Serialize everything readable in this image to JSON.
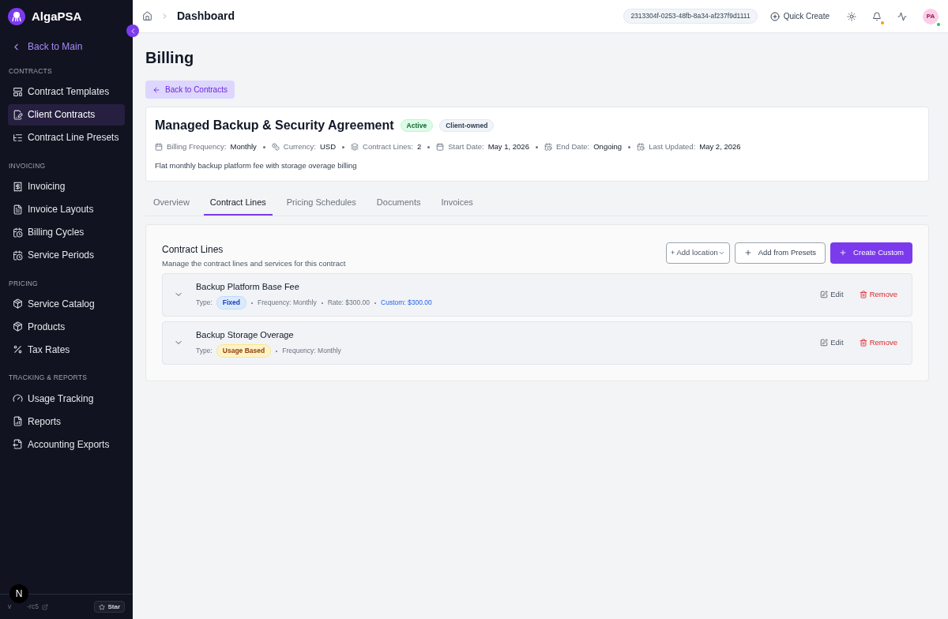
{
  "sidebar": {
    "brand": "AlgaPSA",
    "back": "Back to Main",
    "sections": [
      {
        "title": "CONTRACTS",
        "items": [
          {
            "label": "Contract Templates",
            "selected": false
          },
          {
            "label": "Client Contracts",
            "selected": true
          },
          {
            "label": "Contract Line Presets",
            "selected": false
          }
        ]
      },
      {
        "title": "INVOICING",
        "items": [
          {
            "label": "Invoicing",
            "selected": false
          },
          {
            "label": "Invoice Layouts",
            "selected": false
          },
          {
            "label": "Billing Cycles",
            "selected": false
          },
          {
            "label": "Service Periods",
            "selected": false
          }
        ]
      },
      {
        "title": "PRICING",
        "items": [
          {
            "label": "Service Catalog",
            "selected": false
          },
          {
            "label": "Products",
            "selected": false
          },
          {
            "label": "Tax Rates",
            "selected": false
          }
        ]
      },
      {
        "title": "TRACKING & REPORTS",
        "items": [
          {
            "label": "Usage Tracking",
            "selected": false
          },
          {
            "label": "Reports",
            "selected": false
          },
          {
            "label": "Accounting Exports",
            "selected": false
          }
        ]
      }
    ],
    "version_start": "v",
    "version_end": "-rc5",
    "dev_badge": "N",
    "star": "Star"
  },
  "header": {
    "breadcrumb": "Dashboard",
    "tenant_id": "2313304f-0253-48fb-8a34-af237f9d1111",
    "quick_create": "Quick Create",
    "avatar": "PA"
  },
  "page": {
    "title": "Billing",
    "back_button": "Back to Contracts"
  },
  "contract": {
    "name": "Managed Backup & Security Agreement",
    "badges": [
      {
        "label": "Active",
        "kind": "status"
      },
      {
        "label": "Client-owned",
        "kind": "owner"
      }
    ],
    "meta": [
      {
        "label": "Billing Frequency:",
        "value": "Monthly"
      },
      {
        "label": "Currency:",
        "value": "USD"
      },
      {
        "label": "Contract Lines:",
        "value": "2"
      },
      {
        "label": "Start Date:",
        "value": "May 1, 2026"
      },
      {
        "label": "End Date:",
        "value": "Ongoing"
      },
      {
        "label": "Last Updated:",
        "value": "May 2, 2026"
      }
    ],
    "description": "Flat monthly backup platform fee with storage overage billing"
  },
  "tabs": [
    {
      "label": "Overview",
      "selected": false
    },
    {
      "label": "Contract Lines",
      "selected": true
    },
    {
      "label": "Pricing Schedules",
      "selected": false
    },
    {
      "label": "Documents",
      "selected": false
    },
    {
      "label": "Invoices",
      "selected": false
    }
  ],
  "contract_lines": {
    "title": "Contract Lines",
    "subtitle": "Manage the contract lines and services for this contract",
    "add_location": "+ Add location",
    "add_presets": "Add from Presets",
    "create_custom": "Create Custom",
    "lines": [
      {
        "name": "Backup Platform Base Fee",
        "type_label": "Type:",
        "type": "Fixed",
        "kind": "fixed",
        "details": [
          "Frequency: Monthly",
          "Rate: $300.00"
        ],
        "custom": "Custom: $300.00",
        "edit": "Edit",
        "remove": "Remove"
      },
      {
        "name": "Backup Storage Overage",
        "type_label": "Type:",
        "type": "Usage Based",
        "kind": "usage",
        "details": [
          "Frequency: Monthly"
        ],
        "edit": "Edit",
        "remove": "Remove"
      }
    ]
  }
}
